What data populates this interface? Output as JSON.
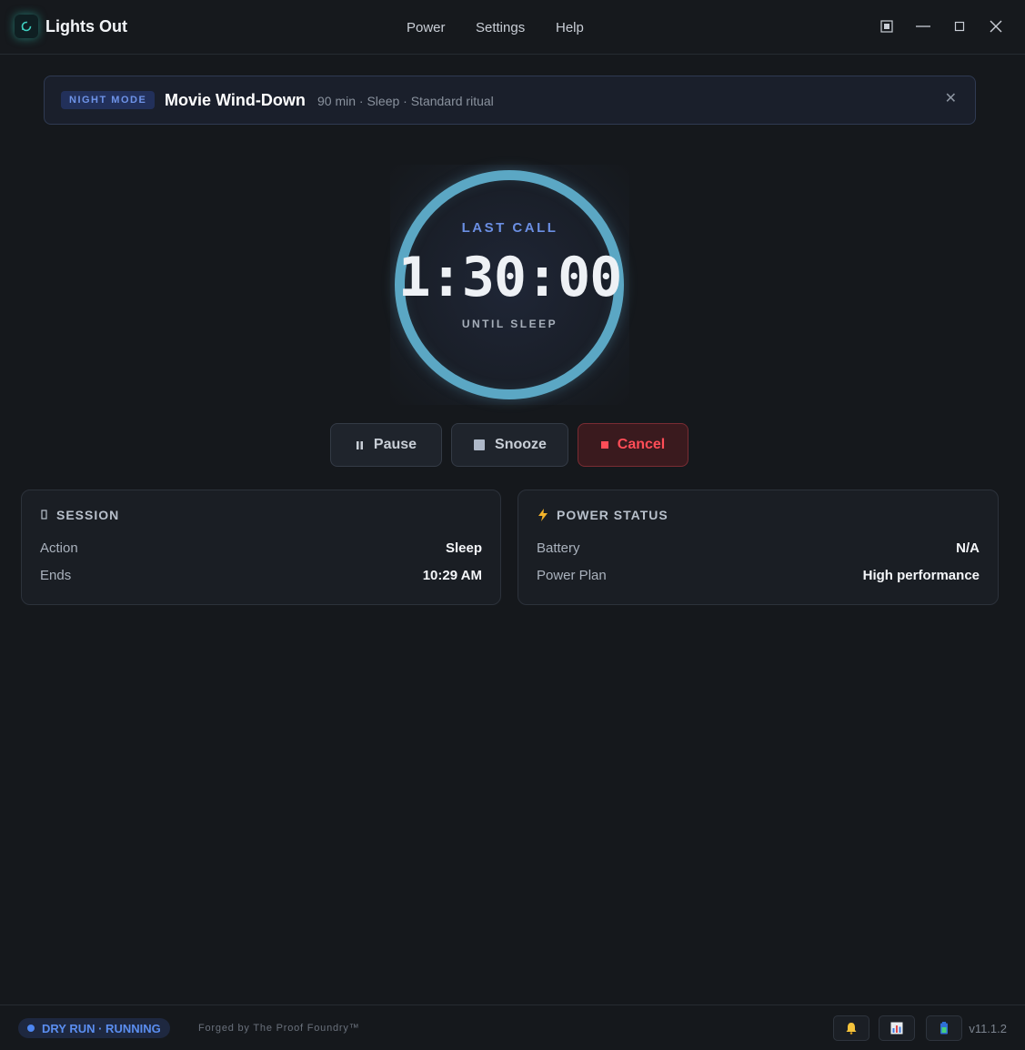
{
  "app": {
    "title": "Lights Out"
  },
  "menu": {
    "items": [
      "Power",
      "Settings",
      "Help"
    ]
  },
  "banner": {
    "badge": "NIGHT MODE",
    "title": "Movie Wind-Down",
    "meta": "90 min · Sleep · Standard ritual",
    "close_label": "✕"
  },
  "timer": {
    "top_label": "LAST CALL",
    "time": "1:30:00",
    "sub_label": "UNTIL SLEEP",
    "progress": 1.0,
    "ring_color": "#5ba7c4"
  },
  "controls": {
    "pause": "Pause",
    "snooze": "Snooze",
    "cancel": "Cancel"
  },
  "session": {
    "title": "SESSION",
    "rows": [
      {
        "label": "Action",
        "value": "Sleep"
      },
      {
        "label": "Ends",
        "value": "10:29 AM"
      }
    ]
  },
  "power_status": {
    "title": "POWER STATUS",
    "rows": [
      {
        "label": "Battery",
        "value": "N/A"
      },
      {
        "label": "Power Plan",
        "value": "High performance"
      }
    ]
  },
  "footer": {
    "status": "DRY RUN · RUNNING",
    "credit": "Forged by The Proof Foundry™",
    "version": "v11.1.2"
  },
  "colors": {
    "accent": "#6b8fe3",
    "cancel": "#ff4d57",
    "status": "#4d86f0"
  },
  "icons": [
    "app-logo-icon",
    "compact-mode-icon",
    "minimize-icon",
    "maximize-icon",
    "close-icon",
    "pause-icon",
    "stop-icon",
    "cancel-icon",
    "session-icon",
    "lightning-icon",
    "bell-icon",
    "chart-icon",
    "battery-icon"
  ]
}
